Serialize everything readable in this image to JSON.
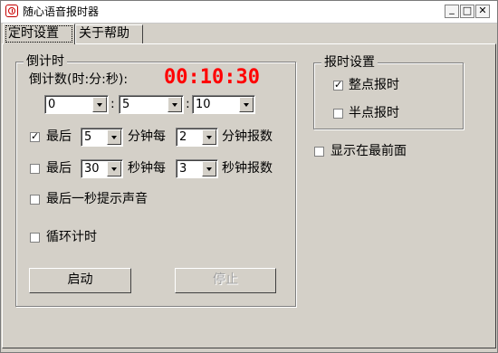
{
  "window": {
    "title": "随心语音报时器",
    "min_glyph": "_",
    "max_glyph": "□",
    "close_glyph": "✕",
    "app_icon": "alarm-clock-icon"
  },
  "tabs": [
    {
      "label": "定时设置",
      "selected": true
    },
    {
      "label": "关于帮助",
      "selected": false
    }
  ],
  "countdown": {
    "group_title": "倒计时",
    "label": "倒计数(时:分:秒):",
    "display": "00:10:30",
    "display_color": "#ff0000",
    "hours": "0",
    "minutes": "5",
    "seconds": "10",
    "sep": ":",
    "rule1": {
      "checked": true,
      "prefix": "最后",
      "value1": "5",
      "mid": "分钟每",
      "value2": "2",
      "suffix": "分钟报数"
    },
    "rule2": {
      "checked": false,
      "prefix": "最后",
      "value1": "30",
      "mid": "秒钟每",
      "value2": "3",
      "suffix": "秒钟报数"
    },
    "last_second_sound": {
      "checked": false,
      "label": "最后一秒提示声音"
    },
    "loop": {
      "checked": false,
      "label": "循环计时"
    },
    "start_label": "启动",
    "stop_label": "停止"
  },
  "report": {
    "group_title": "报时设置",
    "on_the_hour": {
      "checked": true,
      "label": "整点报时"
    },
    "on_the_half_hour": {
      "checked": false,
      "label": "半点报时"
    }
  },
  "topmost": {
    "checked": false,
    "label": "显示在最前面"
  }
}
